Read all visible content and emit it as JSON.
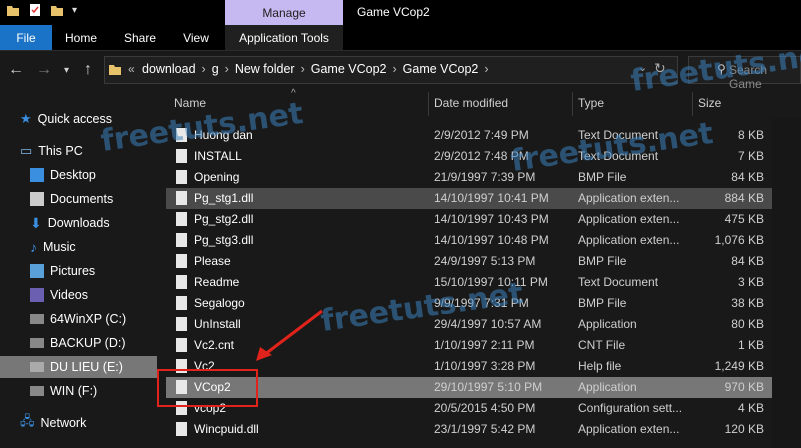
{
  "window": {
    "title": "Game VCop2",
    "manage_tab": "Manage"
  },
  "ribbon": {
    "tabs": [
      "File",
      "Home",
      "Share",
      "View",
      "Application Tools"
    ]
  },
  "address": {
    "crumbs": [
      "download",
      "g",
      "New folder",
      "Game VCop2",
      "Game VCop2"
    ],
    "overflow": "«",
    "search_placeholder": "Search Game"
  },
  "nav": {
    "items": [
      {
        "label": "Quick access",
        "icon": "star-icon"
      },
      {
        "label": "This PC",
        "icon": "pc-icon"
      },
      {
        "label": "Desktop",
        "icon": "desktop-icon"
      },
      {
        "label": "Documents",
        "icon": "documents-icon"
      },
      {
        "label": "Downloads",
        "icon": "downloads-icon"
      },
      {
        "label": "Music",
        "icon": "music-icon"
      },
      {
        "label": "Pictures",
        "icon": "pictures-icon"
      },
      {
        "label": "Videos",
        "icon": "videos-icon"
      },
      {
        "label": "64WinXP  (C:)",
        "icon": "drive-icon"
      },
      {
        "label": "BACKUP (D:)",
        "icon": "drive-icon"
      },
      {
        "label": "DU LIEU (E:)",
        "icon": "drive-icon"
      },
      {
        "label": "WIN (F:)",
        "icon": "drive-icon"
      },
      {
        "label": "Network",
        "icon": "network-icon"
      }
    ]
  },
  "columns": {
    "name": "Name",
    "date": "Date modified",
    "type": "Type",
    "size": "Size"
  },
  "files": [
    {
      "name": "Huong dan",
      "date": "2/9/2012 7:49 PM",
      "type": "Text Document",
      "size": "8 KB"
    },
    {
      "name": "INSTALL",
      "date": "2/9/2012 7:48 PM",
      "type": "Text Document",
      "size": "7 KB"
    },
    {
      "name": "Opening",
      "date": "21/9/1997 7:39 PM",
      "type": "BMP File",
      "size": "84 KB"
    },
    {
      "name": "Pg_stg1.dll",
      "date": "14/10/1997 10:41 PM",
      "type": "Application exten...",
      "size": "884 KB"
    },
    {
      "name": "Pg_stg2.dll",
      "date": "14/10/1997 10:43 PM",
      "type": "Application exten...",
      "size": "475 KB"
    },
    {
      "name": "Pg_stg3.dll",
      "date": "14/10/1997 10:48 PM",
      "type": "Application exten...",
      "size": "1,076 KB"
    },
    {
      "name": "Please",
      "date": "24/9/1997 5:13 PM",
      "type": "BMP File",
      "size": "84 KB"
    },
    {
      "name": "Readme",
      "date": "15/10/1997 10:11 PM",
      "type": "Text Document",
      "size": "3 KB"
    },
    {
      "name": "Segalogo",
      "date": "9/9/1997 7:31 PM",
      "type": "BMP File",
      "size": "38 KB"
    },
    {
      "name": "UnInstall",
      "date": "29/4/1997 10:57 AM",
      "type": "Application",
      "size": "80 KB"
    },
    {
      "name": "Vc2.cnt",
      "date": "1/10/1997 2:11 PM",
      "type": "CNT File",
      "size": "1 KB"
    },
    {
      "name": "Vc2",
      "date": "1/10/1997 3:28 PM",
      "type": "Help file",
      "size": "1,249 KB"
    },
    {
      "name": "VCop2",
      "date": "29/10/1997 5:10 PM",
      "type": "Application",
      "size": "970 KB"
    },
    {
      "name": "vcop2",
      "date": "20/5/2015 4:50 PM",
      "type": "Configuration sett...",
      "size": "4 KB"
    },
    {
      "name": "Wincpuid.dll",
      "date": "23/1/1997 5:42 PM",
      "type": "Application exten...",
      "size": "120 KB"
    }
  ],
  "watermark": "freetuts.net"
}
